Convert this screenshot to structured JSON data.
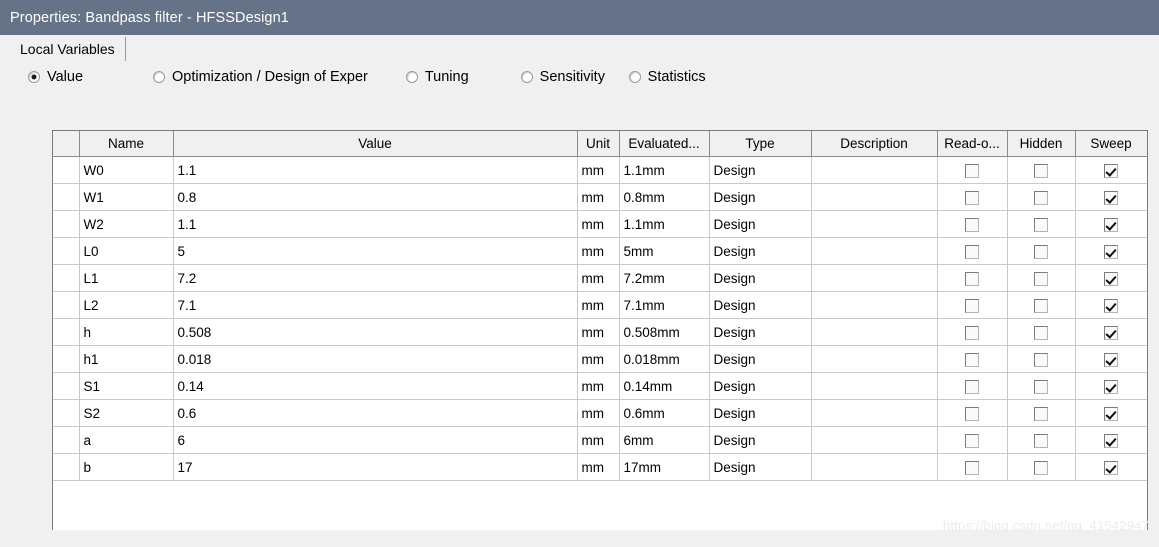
{
  "window": {
    "title": "Properties: Bandpass filter - HFSSDesign1",
    "titlebar_color": "#667288"
  },
  "tabs": [
    {
      "label": "Local Variables",
      "active": true
    }
  ],
  "mode_options": [
    {
      "label": "Value",
      "selected": true
    },
    {
      "label": "Optimization / Design of Exper",
      "selected": false
    },
    {
      "label": "Tuning",
      "selected": false
    },
    {
      "label": "Sensitivity",
      "selected": false
    },
    {
      "label": "Statistics",
      "selected": false
    }
  ],
  "table": {
    "columns": [
      "Name",
      "Value",
      "Unit",
      "Evaluated...",
      "Type",
      "Description",
      "Read-o...",
      "Hidden",
      "Sweep"
    ],
    "rows": [
      {
        "name": "W0",
        "value": "1.1",
        "unit": "mm",
        "evaluated": "1.1mm",
        "type": "Design",
        "description": "",
        "readonly": false,
        "hidden": false,
        "sweep": true
      },
      {
        "name": "W1",
        "value": "0.8",
        "unit": "mm",
        "evaluated": "0.8mm",
        "type": "Design",
        "description": "",
        "readonly": false,
        "hidden": false,
        "sweep": true
      },
      {
        "name": "W2",
        "value": "1.1",
        "unit": "mm",
        "evaluated": "1.1mm",
        "type": "Design",
        "description": "",
        "readonly": false,
        "hidden": false,
        "sweep": true
      },
      {
        "name": "L0",
        "value": "5",
        "unit": "mm",
        "evaluated": "5mm",
        "type": "Design",
        "description": "",
        "readonly": false,
        "hidden": false,
        "sweep": true
      },
      {
        "name": "L1",
        "value": "7.2",
        "unit": "mm",
        "evaluated": "7.2mm",
        "type": "Design",
        "description": "",
        "readonly": false,
        "hidden": false,
        "sweep": true
      },
      {
        "name": "L2",
        "value": "7.1",
        "unit": "mm",
        "evaluated": "7.1mm",
        "type": "Design",
        "description": "",
        "readonly": false,
        "hidden": false,
        "sweep": true
      },
      {
        "name": "h",
        "value": "0.508",
        "unit": "mm",
        "evaluated": "0.508mm",
        "type": "Design",
        "description": "",
        "readonly": false,
        "hidden": false,
        "sweep": true
      },
      {
        "name": "h1",
        "value": "0.018",
        "unit": "mm",
        "evaluated": "0.018mm",
        "type": "Design",
        "description": "",
        "readonly": false,
        "hidden": false,
        "sweep": true
      },
      {
        "name": "S1",
        "value": "0.14",
        "unit": "mm",
        "evaluated": "0.14mm",
        "type": "Design",
        "description": "",
        "readonly": false,
        "hidden": false,
        "sweep": true
      },
      {
        "name": "S2",
        "value": "0.6",
        "unit": "mm",
        "evaluated": "0.6mm",
        "type": "Design",
        "description": "",
        "readonly": false,
        "hidden": false,
        "sweep": true
      },
      {
        "name": "a",
        "value": "6",
        "unit": "mm",
        "evaluated": "6mm",
        "type": "Design",
        "description": "",
        "readonly": false,
        "hidden": false,
        "sweep": true
      },
      {
        "name": "b",
        "value": "17",
        "unit": "mm",
        "evaluated": "17mm",
        "type": "Design",
        "description": "",
        "readonly": false,
        "hidden": false,
        "sweep": true
      }
    ]
  },
  "watermark": "https://blog.csdn.net/qq_41542947"
}
